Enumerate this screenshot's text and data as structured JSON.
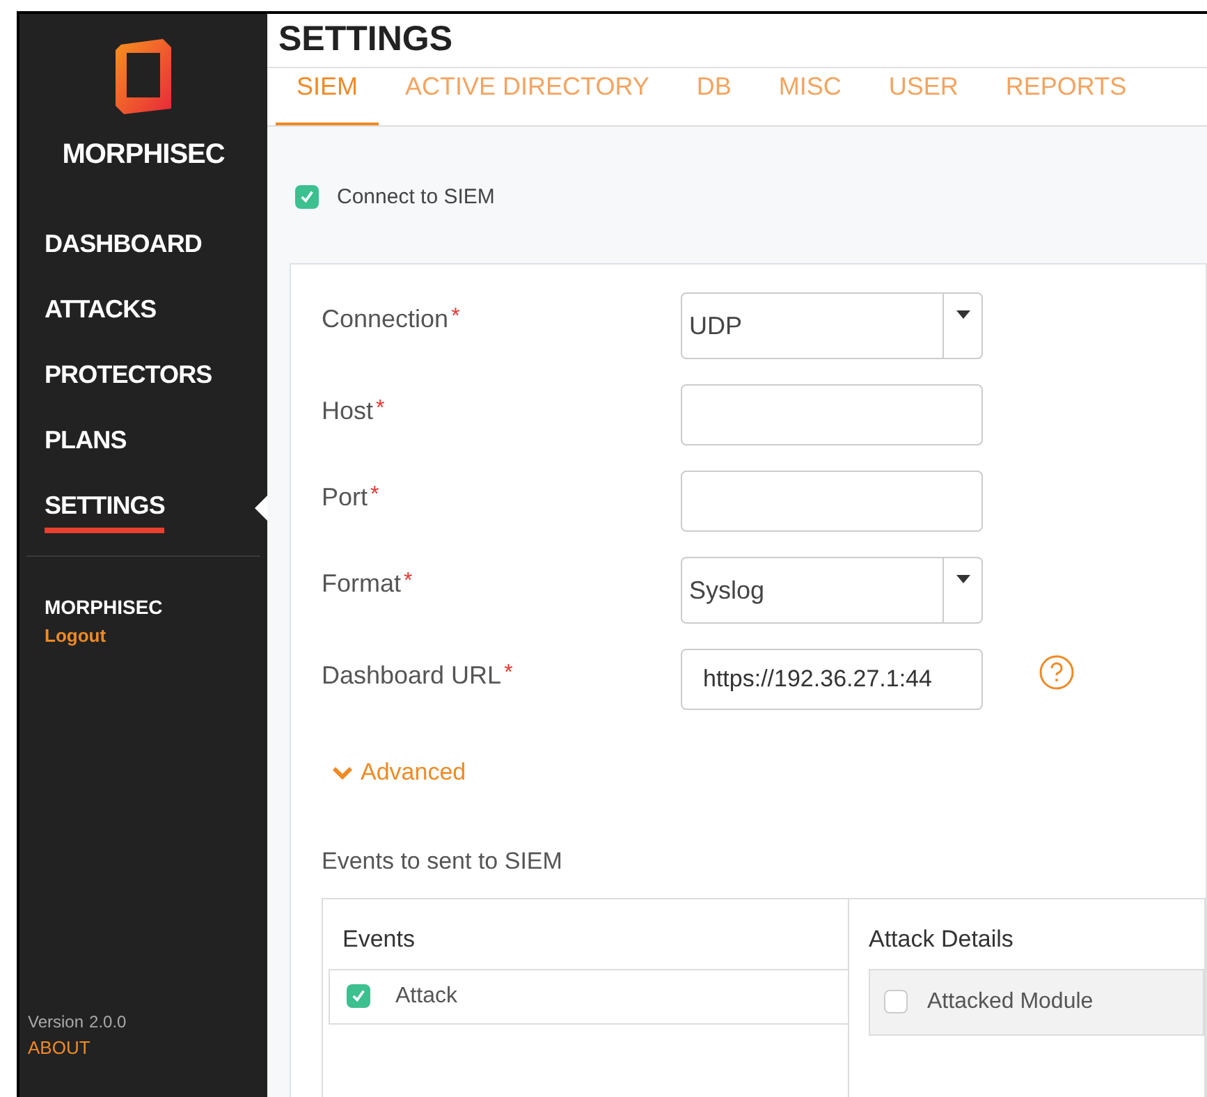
{
  "brand": "MORPHISEC",
  "nav": [
    {
      "label": "DASHBOARD",
      "selected": false
    },
    {
      "label": "ATTACKS",
      "selected": false
    },
    {
      "label": "PROTECTORS",
      "selected": false
    },
    {
      "label": "PLANS",
      "selected": false
    },
    {
      "label": "SETTINGS",
      "selected": true
    }
  ],
  "user": {
    "name": "MORPHISEC",
    "logout": "Logout"
  },
  "version": {
    "label": "Version",
    "number": "2.0.0",
    "about": "ABOUT"
  },
  "page_title": "SETTINGS",
  "tabs": [
    {
      "label": "SIEM",
      "selected": true
    },
    {
      "label": "ACTIVE DIRECTORY",
      "selected": false
    },
    {
      "label": "DB",
      "selected": false
    },
    {
      "label": "MISC",
      "selected": false
    },
    {
      "label": "USER",
      "selected": false
    },
    {
      "label": "REPORTS",
      "selected": false
    }
  ],
  "connect": {
    "label": "Connect to SIEM",
    "checked": true
  },
  "fields": [
    {
      "label": "Connection",
      "required": "*",
      "kind": "select",
      "value": "UDP"
    },
    {
      "label": "Host",
      "required": "*",
      "kind": "text"
    },
    {
      "label": "Port",
      "required": "*",
      "kind": "text"
    },
    {
      "label": "Format",
      "required": "*",
      "kind": "select",
      "value": "Syslog"
    },
    {
      "label": "Dashboard URL",
      "required": "*",
      "kind": "text",
      "value": "https://192.36.27.1:44",
      "help": true
    }
  ],
  "advanced": {
    "label": "Advanced",
    "expanded": true
  },
  "events_title": "Events to sent to SIEM",
  "events": {
    "heading": "Events",
    "items": [
      {
        "label": "Attack",
        "checked": true
      }
    ]
  },
  "attack_details": {
    "heading": "Attack Details",
    "items": [
      {
        "label": "Attacked Module",
        "checked": false
      }
    ]
  }
}
